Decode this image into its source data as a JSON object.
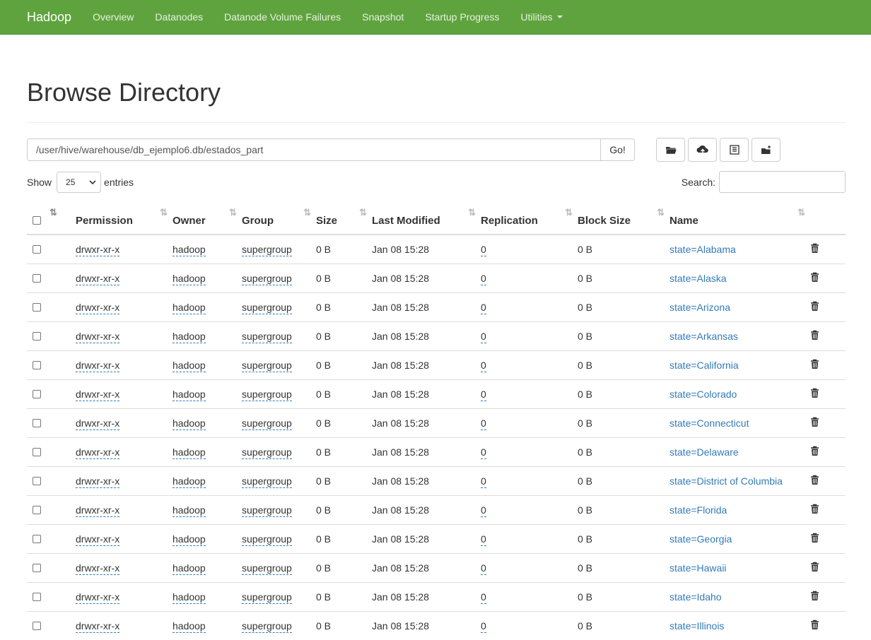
{
  "navbar": {
    "brand": "Hadoop",
    "links": [
      "Overview",
      "Datanodes",
      "Datanode Volume Failures",
      "Snapshot",
      "Startup Progress",
      "Utilities"
    ]
  },
  "page": {
    "title": "Browse Directory",
    "path": "/user/hive/warehouse/db_ejemplo6.db/estados_part",
    "go_label": "Go!",
    "show_label": "Show",
    "entries_value": "25",
    "entries_label": "entries",
    "search_label": "Search:"
  },
  "table": {
    "headers": [
      "Permission",
      "Owner",
      "Group",
      "Size",
      "Last Modified",
      "Replication",
      "Block Size",
      "Name"
    ],
    "rows": [
      {
        "permission": "drwxr-xr-x",
        "owner": "hadoop",
        "group": "supergroup",
        "size": "0 B",
        "modified": "Jan 08 15:28",
        "replication": "0",
        "block": "0 B",
        "name": "state=Alabama"
      },
      {
        "permission": "drwxr-xr-x",
        "owner": "hadoop",
        "group": "supergroup",
        "size": "0 B",
        "modified": "Jan 08 15:28",
        "replication": "0",
        "block": "0 B",
        "name": "state=Alaska"
      },
      {
        "permission": "drwxr-xr-x",
        "owner": "hadoop",
        "group": "supergroup",
        "size": "0 B",
        "modified": "Jan 08 15:28",
        "replication": "0",
        "block": "0 B",
        "name": "state=Arizona"
      },
      {
        "permission": "drwxr-xr-x",
        "owner": "hadoop",
        "group": "supergroup",
        "size": "0 B",
        "modified": "Jan 08 15:28",
        "replication": "0",
        "block": "0 B",
        "name": "state=Arkansas"
      },
      {
        "permission": "drwxr-xr-x",
        "owner": "hadoop",
        "group": "supergroup",
        "size": "0 B",
        "modified": "Jan 08 15:28",
        "replication": "0",
        "block": "0 B",
        "name": "state=California"
      },
      {
        "permission": "drwxr-xr-x",
        "owner": "hadoop",
        "group": "supergroup",
        "size": "0 B",
        "modified": "Jan 08 15:28",
        "replication": "0",
        "block": "0 B",
        "name": "state=Colorado"
      },
      {
        "permission": "drwxr-xr-x",
        "owner": "hadoop",
        "group": "supergroup",
        "size": "0 B",
        "modified": "Jan 08 15:28",
        "replication": "0",
        "block": "0 B",
        "name": "state=Connecticut"
      },
      {
        "permission": "drwxr-xr-x",
        "owner": "hadoop",
        "group": "supergroup",
        "size": "0 B",
        "modified": "Jan 08 15:28",
        "replication": "0",
        "block": "0 B",
        "name": "state=Delaware"
      },
      {
        "permission": "drwxr-xr-x",
        "owner": "hadoop",
        "group": "supergroup",
        "size": "0 B",
        "modified": "Jan 08 15:28",
        "replication": "0",
        "block": "0 B",
        "name": "state=District of Columbia"
      },
      {
        "permission": "drwxr-xr-x",
        "owner": "hadoop",
        "group": "supergroup",
        "size": "0 B",
        "modified": "Jan 08 15:28",
        "replication": "0",
        "block": "0 B",
        "name": "state=Florida"
      },
      {
        "permission": "drwxr-xr-x",
        "owner": "hadoop",
        "group": "supergroup",
        "size": "0 B",
        "modified": "Jan 08 15:28",
        "replication": "0",
        "block": "0 B",
        "name": "state=Georgia"
      },
      {
        "permission": "drwxr-xr-x",
        "owner": "hadoop",
        "group": "supergroup",
        "size": "0 B",
        "modified": "Jan 08 15:28",
        "replication": "0",
        "block": "0 B",
        "name": "state=Hawaii"
      },
      {
        "permission": "drwxr-xr-x",
        "owner": "hadoop",
        "group": "supergroup",
        "size": "0 B",
        "modified": "Jan 08 15:28",
        "replication": "0",
        "block": "0 B",
        "name": "state=Idaho"
      },
      {
        "permission": "drwxr-xr-x",
        "owner": "hadoop",
        "group": "supergroup",
        "size": "0 B",
        "modified": "Jan 08 15:28",
        "replication": "0",
        "block": "0 B",
        "name": "state=Illinois"
      }
    ]
  },
  "icons": [
    "folder-icon",
    "upload-icon",
    "list-icon",
    "cut-icon",
    "trash-icon",
    "sort-icon"
  ],
  "colors": {
    "navbar": "#5fa33e",
    "link": "#337ab7"
  }
}
